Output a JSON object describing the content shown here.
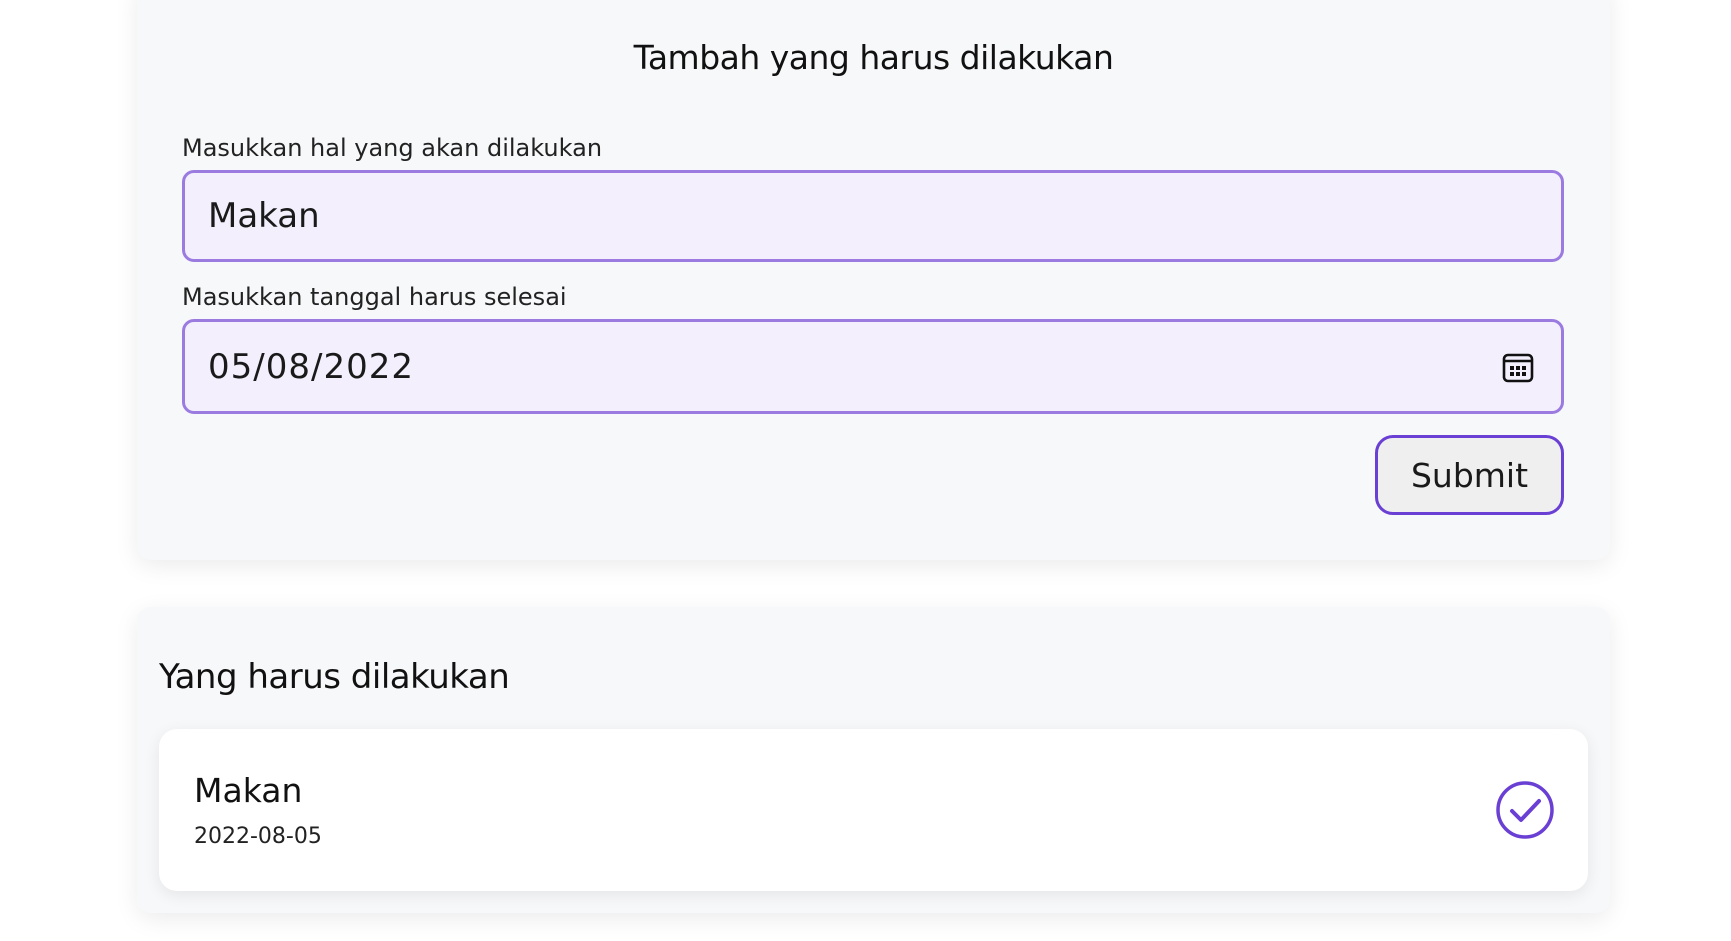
{
  "form": {
    "title": "Tambah yang harus dilakukan",
    "task_label": "Masukkan hal yang akan dilakukan",
    "task_value": "Makan",
    "date_label": "Masukkan tanggal harus selesai",
    "date_value": "05/08/2022",
    "date_icon": "calendar-icon",
    "submit_label": "Submit"
  },
  "list": {
    "title": "Yang harus dilakukan",
    "items": [
      {
        "title": "Makan",
        "date": "2022-08-05",
        "action_icon": "check-circle-icon"
      }
    ]
  },
  "colors": {
    "accent": "#6a3fd4",
    "input_border": "#9b7be0",
    "input_background": "#f3effd",
    "card_background": "#f7f8fa"
  }
}
